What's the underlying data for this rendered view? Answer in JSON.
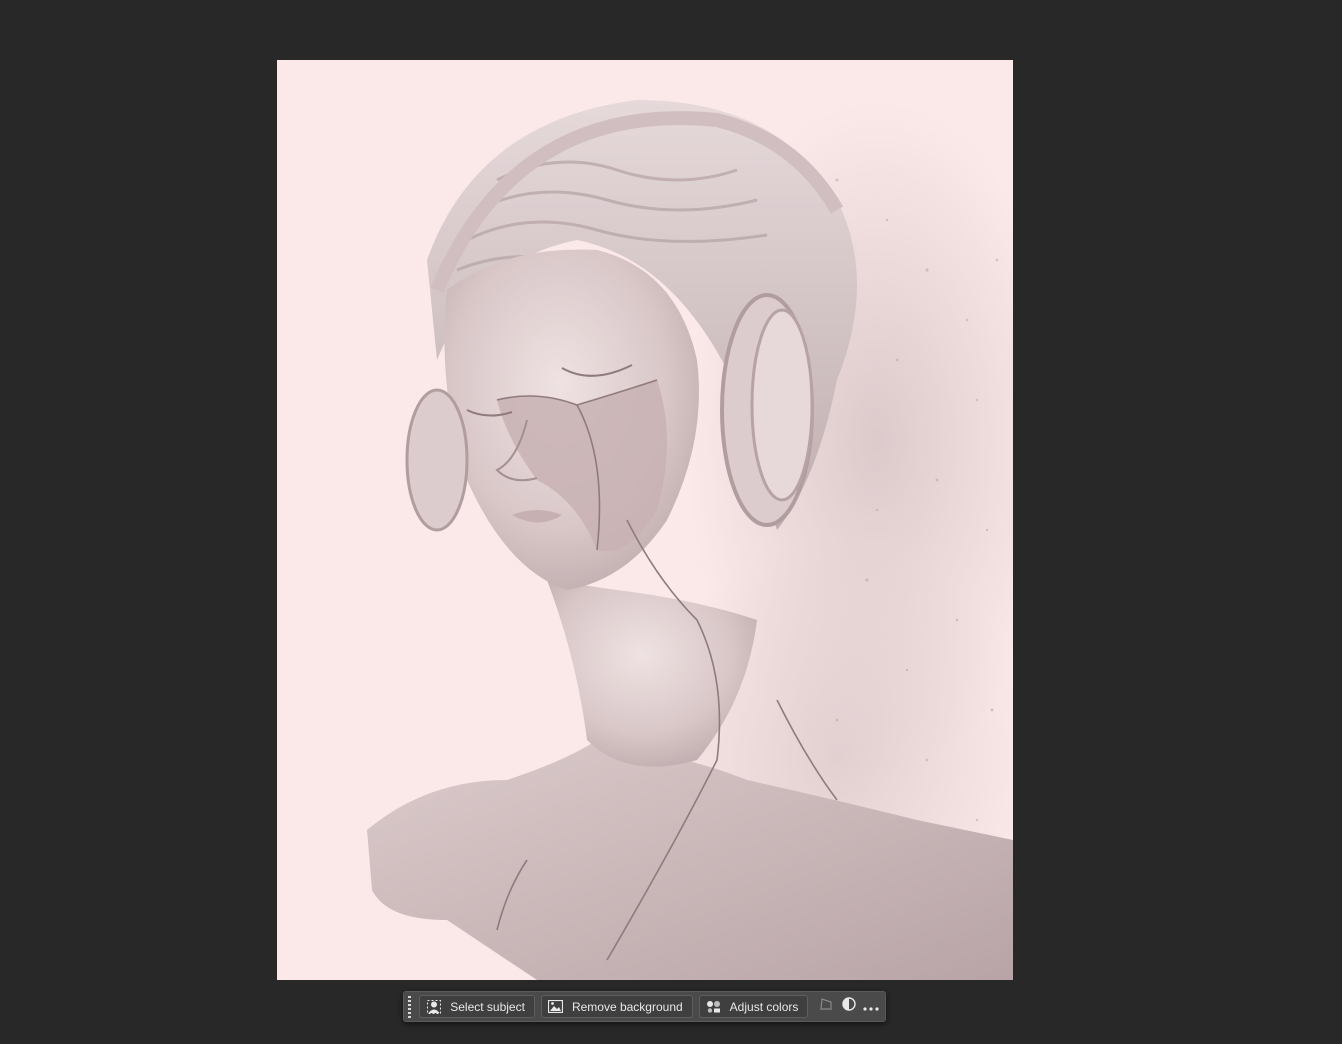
{
  "canvas": {
    "background_color": "#fbe9e9",
    "image_subject": "statue-bust-with-headphones"
  },
  "taskbar": {
    "select_subject_label": "Select subject",
    "remove_background_label": "Remove background",
    "adjust_colors_label": "Adjust colors",
    "icons": {
      "select_subject": "person-select-icon",
      "remove_background": "image-remove-icon",
      "adjust_colors": "color-adjust-icon",
      "transform": "transform-icon",
      "contrast": "contrast-icon",
      "more": "more-options-icon"
    }
  }
}
